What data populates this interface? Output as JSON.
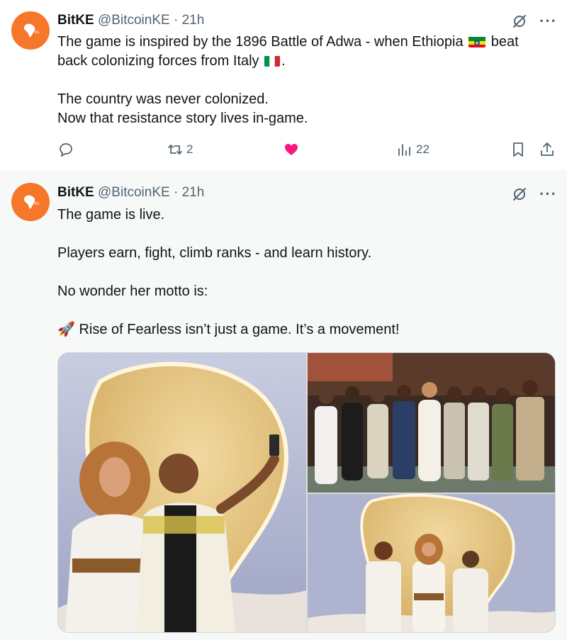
{
  "tweets": [
    {
      "display_name": "BitKE",
      "handle": "@BitcoinKE",
      "separator": "·",
      "time": "21h",
      "lines": {
        "l1a": "The game is inspired by the 1896 Battle of Adwa - when Ethiopia",
        "l1b": "beat",
        "l2a": "back colonizing forces from Italy",
        "l2b": ".",
        "l3": "The country was never colonized.",
        "l4": "Now that resistance story lives in-game."
      },
      "actions": {
        "reply_count": "",
        "repost_count": "2",
        "like_count": "",
        "views_count": "22"
      }
    },
    {
      "display_name": "BitKE",
      "handle": "@BitcoinKE",
      "separator": "·",
      "time": "21h",
      "lines": {
        "l1": "The game is live.",
        "l2": "Players earn, fight, climb ranks - and learn history.",
        "l3": "No wonder her motto is:",
        "l4": "🚀 Rise of Fearless isn’t just a game. It’s a movement!"
      }
    }
  ],
  "icons": {
    "avatar": "africa-logo-icon",
    "grok": "grok-icon",
    "more": "more-icon",
    "reply": "reply-icon",
    "repost": "repost-icon",
    "like": "heart-icon",
    "views": "views-icon",
    "bookmark": "bookmark-icon",
    "share": "share-icon"
  },
  "colors": {
    "avatar_bg": "#f6762a",
    "like_active": "#f91880",
    "secondary_text": "#536471"
  },
  "more_glyph": "···"
}
